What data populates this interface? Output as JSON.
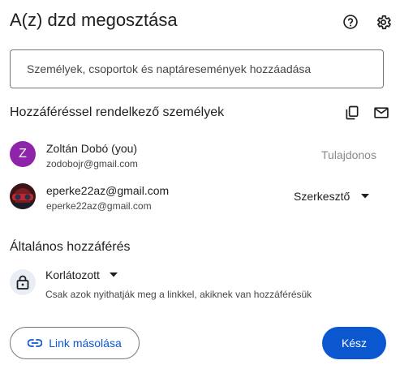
{
  "dialog": {
    "title": "A(z) dzd megosztása",
    "help_icon": "help-circle-icon",
    "settings_icon": "gear-icon"
  },
  "search": {
    "placeholder": "Személyek, csoportok és naptáresemények hozzáadása"
  },
  "people_section": {
    "heading": "Hozzáféréssel rendelkező személyek",
    "copy_icon": "copy-icon",
    "email_icon": "mail-icon",
    "people": [
      {
        "initial": "Z",
        "name": "Zoltán Dobó (you)",
        "email": "zodobojr@gmail.com",
        "role": "Tulajdonos",
        "avatar_color": "#8e24aa"
      },
      {
        "name": "eperke22az@gmail.com",
        "email": "eperke22az@gmail.com",
        "role": "Szerkesztő"
      }
    ]
  },
  "general_access": {
    "heading": "Általános hozzáférés",
    "level": "Korlátozott",
    "description": "Csak azok nyithatják meg a linkkel, akiknek van hozzáférésük",
    "lock_icon": "lock-icon"
  },
  "actions": {
    "copy_link": "Link másolása",
    "link_icon": "link-icon",
    "done": "Kész"
  },
  "colors": {
    "accent": "#0b57d0",
    "avatar_z": "#8e24aa",
    "lock_bg": "#e9eef6"
  }
}
